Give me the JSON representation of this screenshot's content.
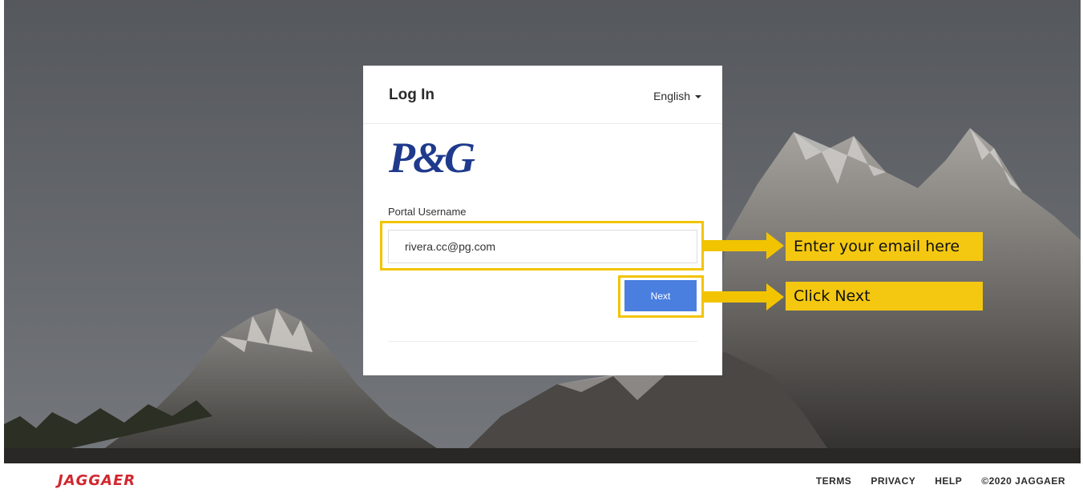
{
  "login": {
    "title": "Log In",
    "language": "English",
    "logo_text": "P&G",
    "username_label": "Portal Username",
    "username_value": "rivera.cc@pg.com",
    "next_label": "Next"
  },
  "annotations": {
    "email_callout": "Enter your email here",
    "next_callout": "Click Next"
  },
  "footer": {
    "brand": "JAGGAER",
    "links": [
      "TERMS",
      "PRIVACY",
      "HELP"
    ],
    "copyright": "©2020 JAGGAER"
  },
  "colors": {
    "accent": "#4a7fe0",
    "highlight": "#f2c400",
    "brand": "#d1272f",
    "logo": "#1f3a8c"
  }
}
